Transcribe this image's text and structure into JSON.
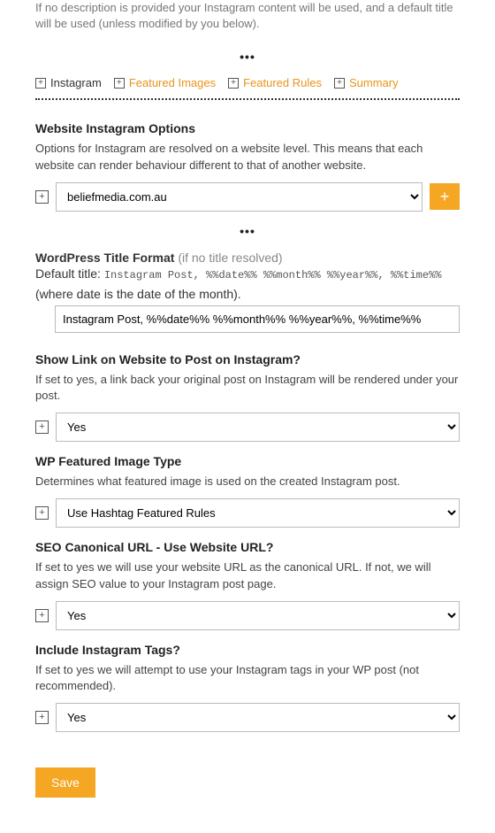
{
  "top_desc": "If no description is provided your Instagram content will be used, and a default title will be used (unless modified by you below).",
  "ellipsis": "•••",
  "tabs": {
    "instagram": "Instagram",
    "featured_images": "Featured Images",
    "featured_rules": "Featured Rules",
    "summary": "Summary"
  },
  "website_options": {
    "title": "Website Instagram Options",
    "desc": "Options for Instagram are resolved on a website level. This means that each website can render behaviour different to that of another website.",
    "selected": "beliefmedia.com.au",
    "add_label": "+"
  },
  "title_format": {
    "label_bold": "WordPress Title Format",
    "label_gray": "(if no title resolved)",
    "default_prefix": "Default title:",
    "default_code": "Instagram Post, %%date%% %%month%% %%year%%, %%time%%",
    "default_suffix": "(where date is the date of the month).",
    "input_value": "Instagram Post, %%date%% %%month%% %%year%%, %%time%%"
  },
  "show_link": {
    "label": "Show Link on Website to Post on Instagram?",
    "desc": "If set to yes, a link back your original post on Instagram will be rendered under your post.",
    "value": "Yes"
  },
  "featured_type": {
    "label": "WP Featured Image Type",
    "desc": "Determines what featured image is used on the created Instagram post.",
    "value": "Use Hashtag Featured Rules"
  },
  "canonical": {
    "label": "SEO Canonical URL - Use Website URL?",
    "desc": "If set to yes we will use your website URL as the canonical URL. If not, we will assign SEO value to your Instagram post page.",
    "value": "Yes"
  },
  "include_tags": {
    "label": "Include Instagram Tags?",
    "desc": "If set to yes we will attempt to use your Instagram tags in your WP post (not recommended).",
    "value": "Yes"
  },
  "save_label": "Save"
}
